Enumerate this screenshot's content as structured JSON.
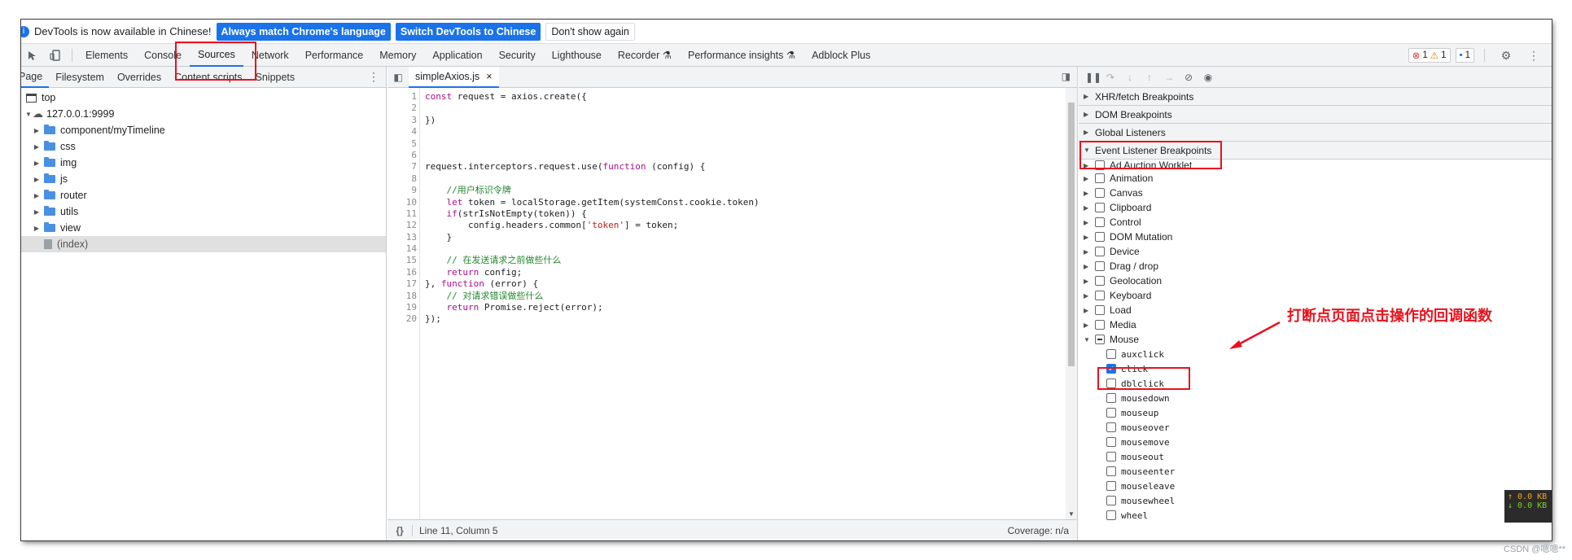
{
  "infobar": {
    "message": "DevTools is now available in Chinese!",
    "match_button": "Always match Chrome's language",
    "switch_button": "Switch DevTools to Chinese",
    "dismiss_button": "Don't show again"
  },
  "main_tabs": [
    "Elements",
    "Console",
    "Sources",
    "Network",
    "Performance",
    "Memory",
    "Application",
    "Security",
    "Lighthouse",
    "Recorder ⚗",
    "Performance insights ⚗",
    "Adblock Plus"
  ],
  "active_main_tab": "Sources",
  "counters": {
    "errors": "1",
    "warnings": "1",
    "messages": "1"
  },
  "navigator": {
    "tabs": [
      "Page",
      "Filesystem",
      "Overrides",
      "Content scripts",
      "Snippets"
    ],
    "tree": {
      "top": "top",
      "host": "127.0.0.1:9999",
      "folders": [
        "component/myTimeline",
        "css",
        "img",
        "js",
        "router",
        "utils",
        "view"
      ],
      "selected_file": "(index)"
    }
  },
  "editor": {
    "file_tab": "simpleAxios.js",
    "close_glyph": "×",
    "status_cursor": "Line 11, Column 5",
    "status_coverage": "Coverage: n/a",
    "pretty_print": "{}",
    "lines": [
      "1",
      "2",
      "3",
      "4",
      "5",
      "6",
      "7",
      "8",
      "9",
      "10",
      "11",
      "12",
      "13",
      "14",
      "15",
      "16",
      "17",
      "18",
      "19",
      "20"
    ]
  },
  "debugger": {
    "panes": [
      "XHR/fetch Breakpoints",
      "DOM Breakpoints",
      "Global Listeners",
      "Event Listener Breakpoints"
    ],
    "categories": [
      "Ad Auction Worklet",
      "Animation",
      "Canvas",
      "Clipboard",
      "Control",
      "DOM Mutation",
      "Device",
      "Drag / drop",
      "Geolocation",
      "Keyboard",
      "Load",
      "Media"
    ],
    "mouse_category": "Mouse",
    "mouse_events": [
      "auxclick",
      "click",
      "dblclick",
      "mousedown",
      "mouseup",
      "mouseover",
      "mousemove",
      "mouseout",
      "mouseenter",
      "mouseleave",
      "mousewheel",
      "wheel"
    ],
    "checked_event": "click"
  },
  "annotation": {
    "text": "打断点页面点击操作的回调函数",
    "color": "#e8121d"
  },
  "speed_widget": {
    "up": "↑ 0.0 KB",
    "down": "↓ 0.0 KB"
  },
  "watermark": "CSDN @嗯嗯**",
  "colors": {
    "accent": "#1a73e8",
    "annotation_red": "#e8121d"
  }
}
